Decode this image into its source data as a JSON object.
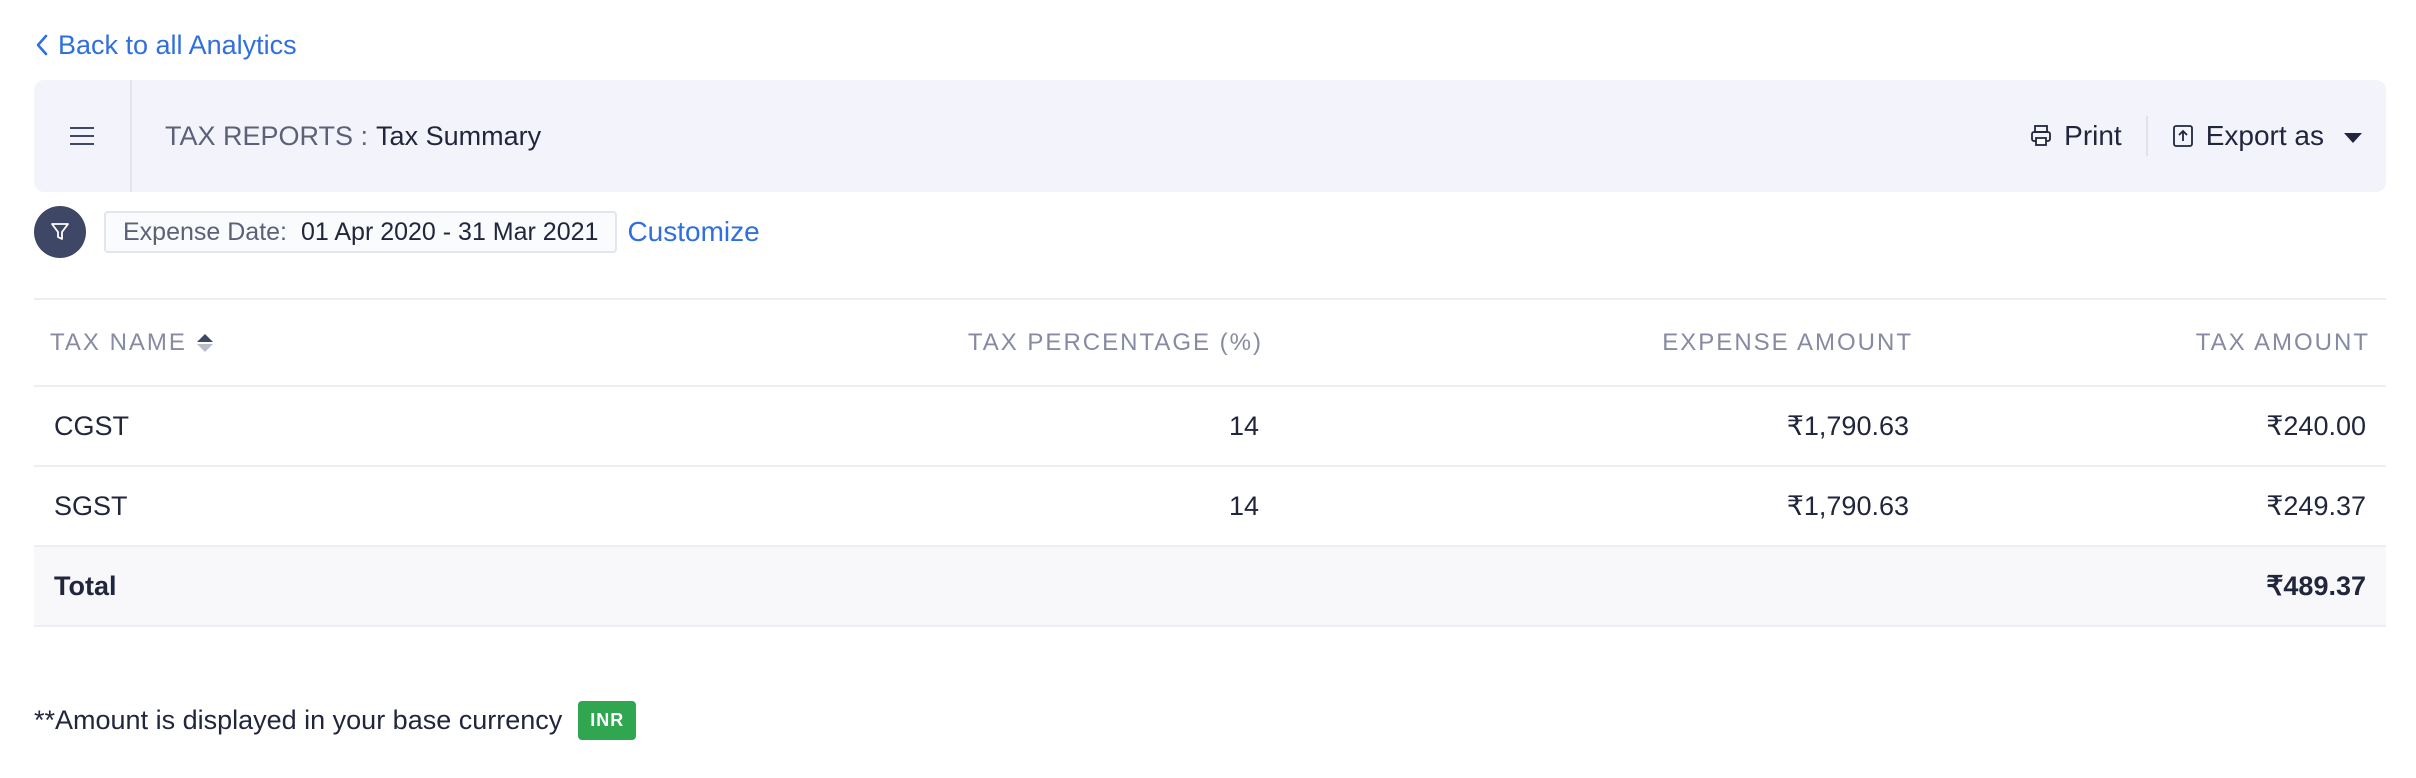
{
  "nav": {
    "back_label": "Back to all Analytics"
  },
  "header": {
    "prefix": "TAX REPORTS :",
    "title": "Tax Summary",
    "print_label": "Print",
    "export_label": "Export as"
  },
  "filter": {
    "label": "Expense Date:",
    "value": "01 Apr 2020 - 31 Mar 2021",
    "customize_label": "Customize"
  },
  "table": {
    "columns": {
      "name": "TAX NAME",
      "percentage": "TAX PERCENTAGE (%)",
      "expense": "EXPENSE AMOUNT",
      "tax": "TAX AMOUNT"
    },
    "rows": [
      {
        "name": "CGST",
        "percentage": "14",
        "expense": "₹1,790.63",
        "tax": "₹240.00"
      },
      {
        "name": "SGST",
        "percentage": "14",
        "expense": "₹1,790.63",
        "tax": "₹249.37"
      }
    ],
    "total": {
      "label": "Total",
      "tax": "₹489.37"
    }
  },
  "footer": {
    "note": "**Amount is displayed in your base currency",
    "currency_badge": "INR"
  },
  "colors": {
    "accent": "#2f6fe0",
    "header_bg": "#f3f4fb",
    "filter_btn_bg": "#3f4766",
    "badge_bg": "#2fa64f"
  }
}
